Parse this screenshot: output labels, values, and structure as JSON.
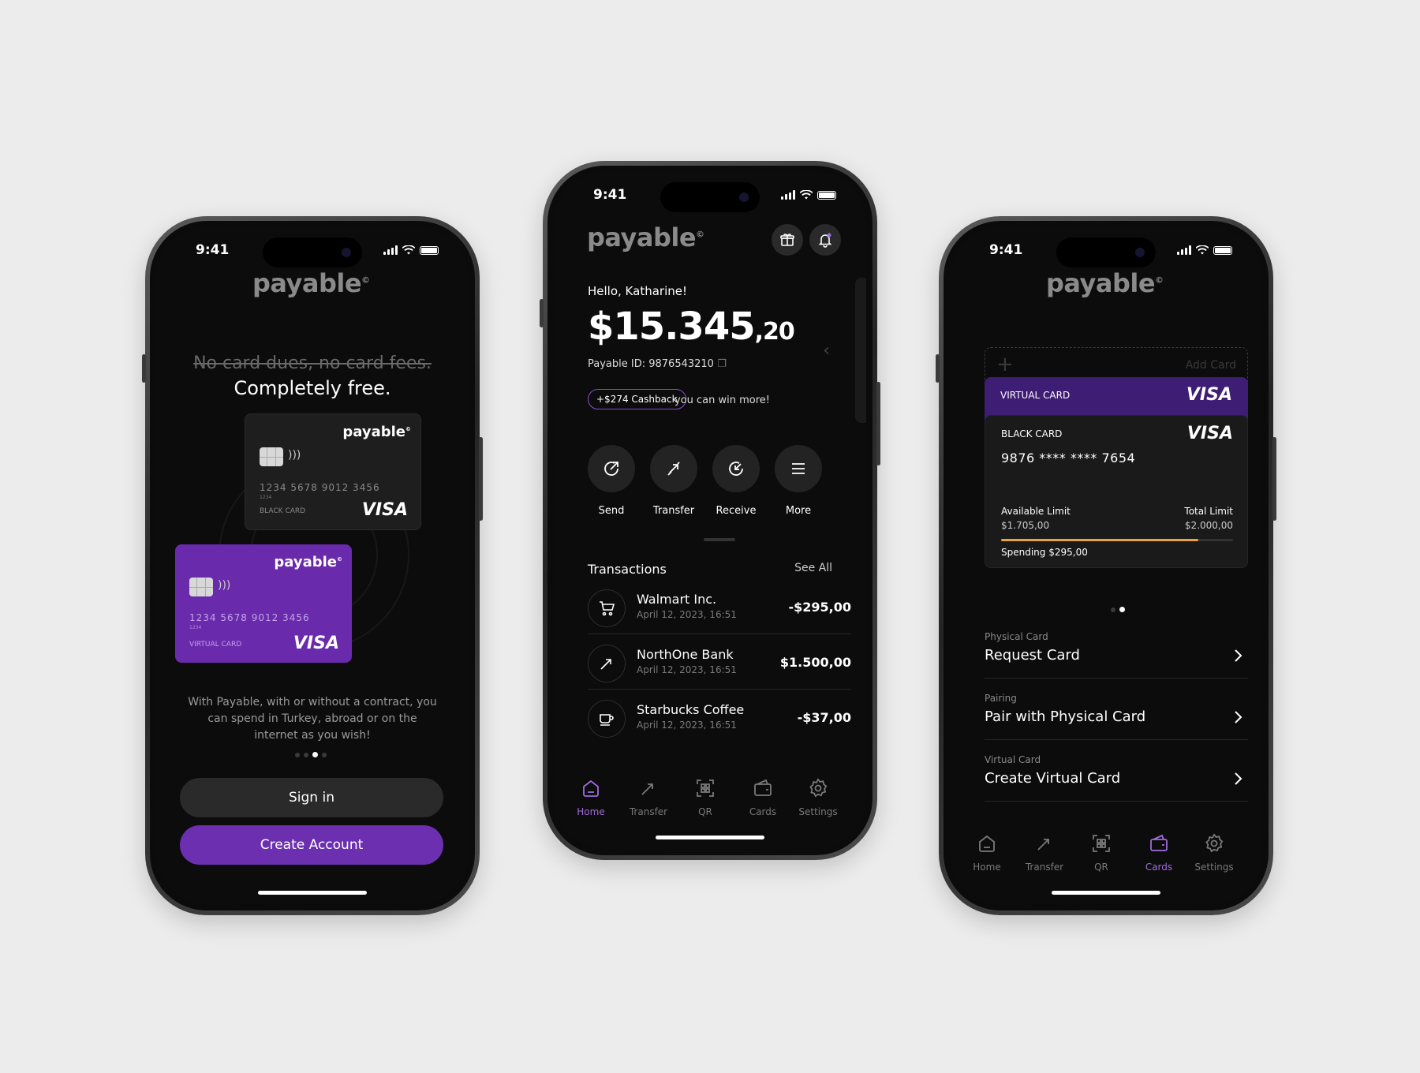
{
  "status": {
    "time": "9:41"
  },
  "brand": {
    "name": "payable",
    "mark": "©"
  },
  "onboarding": {
    "strike_text": "No card dues, no card fees.",
    "headline": "Completely free.",
    "black_card": {
      "number": "1234  5678  9012  3456",
      "sub": "1234",
      "type": "BLACK CARD",
      "network": "VISA"
    },
    "virtual_card": {
      "number": "1234  5678  9012  3456",
      "sub": "1234",
      "type": "VIRTUAL CARD",
      "network": "VISA"
    },
    "description": "With Payable, with or without a contract, you can spend in Turkey, abroad or on the internet as you wish!",
    "page_dots": {
      "count": 4,
      "active": 2
    },
    "sign_in_label": "Sign in",
    "create_account_label": "Create Account"
  },
  "home": {
    "greeting": "Hello, Katharine!",
    "balance_main": "$15.345",
    "balance_cents": ",20",
    "payable_id": "Payable ID: 9876543210",
    "cashback_badge": "+$274 Cashback",
    "cashback_note": "you can win more!",
    "actions": [
      {
        "label": "Send",
        "icon": "send-icon"
      },
      {
        "label": "Transfer",
        "icon": "transfer-icon"
      },
      {
        "label": "Receive",
        "icon": "receive-icon"
      },
      {
        "label": "More",
        "icon": "menu-icon"
      }
    ],
    "transactions_title": "Transactions",
    "see_all": "See All",
    "transactions": [
      {
        "name": "Walmart Inc.",
        "date": "April 12, 2023, 16:51",
        "amount": "-$295,00",
        "icon": "cart-icon"
      },
      {
        "name": "NorthOne Bank",
        "date": "April 12, 2023, 16:51",
        "amount": "$1.500,00",
        "icon": "transfer-icon"
      },
      {
        "name": "Starbucks Coffee",
        "date": "April 12, 2023, 16:51",
        "amount": "-$37,00",
        "icon": "coffee-icon"
      }
    ]
  },
  "cards": {
    "add_card": "Add Card",
    "virtual": {
      "type": "VIRTUAL CARD",
      "network": "VISA"
    },
    "black": {
      "type": "BLACK CARD",
      "network": "VISA",
      "number": "9876 **** **** 7654",
      "available_label": "Available Limit",
      "available_value": "$1.705,00",
      "total_label": "Total Limit",
      "total_value": "$2.000,00",
      "spending": "Spending $295,00",
      "spent_fraction": 0.85
    },
    "page_dots": {
      "count": 2,
      "active": 1
    },
    "options": [
      {
        "section": "Physical Card",
        "title": "Request Card"
      },
      {
        "section": "Pairing",
        "title": "Pair with Physical Card"
      },
      {
        "section": "Virtual Card",
        "title": "Create Virtual Card"
      }
    ]
  },
  "tabbar": [
    {
      "label": "Home",
      "icon": "home-icon"
    },
    {
      "label": "Transfer",
      "icon": "transfer-icon"
    },
    {
      "label": "QR",
      "icon": "qr-icon"
    },
    {
      "label": "Cards",
      "icon": "wallet-icon"
    },
    {
      "label": "Settings",
      "icon": "gear-icon"
    }
  ],
  "colors": {
    "accent": "#6b2fb0",
    "accent_light": "#a06be0",
    "progress": "#e8a33c"
  }
}
